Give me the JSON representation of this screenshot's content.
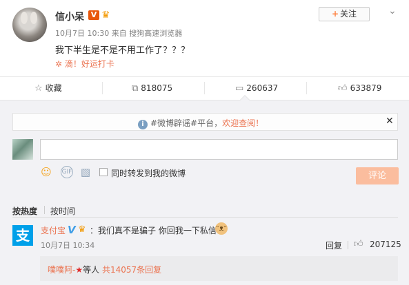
{
  "post": {
    "username": "信小呆",
    "verified_badge": "V",
    "timestamp": "10月7日 10:30",
    "source_prefix": "来自",
    "source": "搜狗高速浏览器",
    "text": "我下半生是不是不用工作了？？？",
    "checkin": "滴！好运打卡",
    "follow_label": "关注",
    "follow_plus": "+"
  },
  "actions": {
    "favorite": "收藏",
    "repost_count": "818075",
    "comment_count": "260637",
    "like_count": "633879"
  },
  "notice": {
    "prefix": "#微博辟谣#平台，",
    "highlight": "欢迎查阅！"
  },
  "composer": {
    "input_value": "",
    "repost_checkbox_label": "同时转发到我的微博",
    "repost_checked": false,
    "submit_label": "评论"
  },
  "sort": {
    "hot": "按热度",
    "time": "按时间"
  },
  "comment": {
    "user": "支付宝",
    "avatar_glyph": "支",
    "verified_badge": "V",
    "text": "：我们真不是骗子 你回我一下私信",
    "time": "10月7日 10:34",
    "reply_label": "回复",
    "like_count": "207125",
    "sub_user": "噗噗阿-",
    "sub_middle": "等人",
    "sub_link": "共14057条回复"
  },
  "colors": {
    "accent": "#eb7350",
    "verified": "#e8580c",
    "submit_disabled": "#fbbd9e",
    "panel_bg": "#f2f2f5",
    "alipay_blue": "#00a0e9"
  },
  "icons": [
    "star-icon",
    "repost-icon",
    "comment-icon",
    "like-icon",
    "info-icon",
    "close-icon",
    "emoji-icon",
    "gif-icon",
    "image-icon",
    "chevron-down-icon",
    "crown-icon",
    "checkin-icon"
  ]
}
